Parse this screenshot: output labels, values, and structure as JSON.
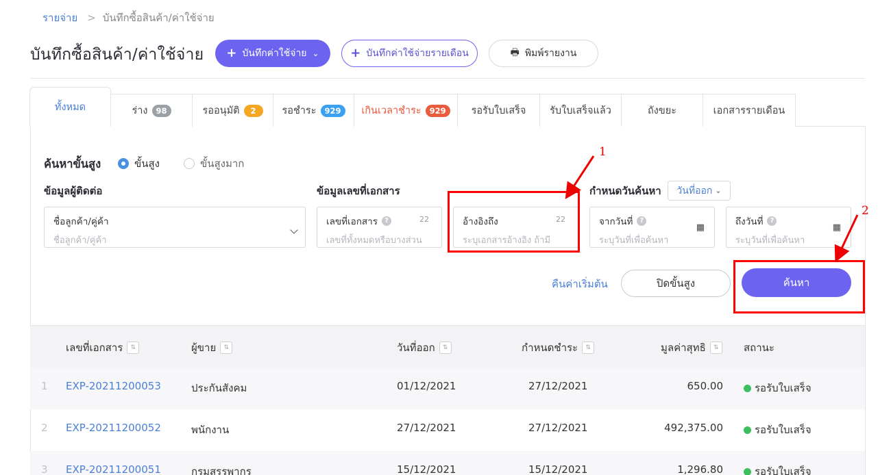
{
  "breadcrumb": {
    "root": "รายจ่าย",
    "separator": ">",
    "current": "บันทึกซื้อสินค้า/ค่าใช้จ่าย"
  },
  "page": {
    "title": "บันทึกซื้อสินค้า/ค่าใช้จ่าย"
  },
  "toolbar": {
    "add_expense": "บันทึกค่าใช้จ่าย",
    "add_monthly": "บันทึกค่าใช้จ่ายรายเดือน",
    "print_report": "พิมพ์รายงาน"
  },
  "tabs": [
    {
      "label": "ทั้งหมด"
    },
    {
      "label": "ร่าง",
      "badge": "98"
    },
    {
      "label": "รออนุมัติ",
      "badge": "2"
    },
    {
      "label": "รอชำระ",
      "badge": "929"
    },
    {
      "label": "เกินเวลาชำระ",
      "badge": "929"
    },
    {
      "label": "รอรับใบเสร็จ"
    },
    {
      "label": "รับใบเสร็จแล้ว"
    },
    {
      "label": "ถังขยะ"
    },
    {
      "label": "เอกสารรายเดือน"
    }
  ],
  "search": {
    "title": "ค้นหาขั้นสูง",
    "mode_advanced": "ขั้นสูง",
    "mode_very_advanced": "ขั้นสูงมาก",
    "section_contact": "ข้อมูลผู้ติดต่อ",
    "section_doc": "ข้อมูลเลขที่เอกสาร",
    "section_date": "กำหนดวันค้นหา",
    "date_type": "วันที่ออก",
    "contact_label": "ชื่อลูกค้า/คู่ค้า",
    "contact_placeholder": "ชื่อลูกค้า/คู่ค้า",
    "doc_label": "เลขที่เอกสาร",
    "doc_count": "22",
    "doc_placeholder": "เลขที่ทั้งหมดหรือบางส่วน",
    "ref_label": "อ้างอิงถึง",
    "ref_count": "22",
    "ref_placeholder": "ระบุเอกสารอ้างอิง ถ้ามี",
    "from_label": "จากวันที่",
    "from_placeholder": "ระบุวันที่เพื่อค้นหา",
    "to_label": "ถึงวันที่",
    "to_placeholder": "ระบุวันที่เพื่อค้นหา",
    "reset": "คืนค่าเริ่มต้น",
    "close_advanced": "ปิดขั้นสูง",
    "submit": "ค้นหา"
  },
  "annotations": {
    "one": "1",
    "two": "2"
  },
  "table": {
    "headers": {
      "doc_no": "เลขที่เอกสาร",
      "vendor": "ผู้ขาย",
      "issue_date": "วันที่ออก",
      "due_date": "กำหนดชำระ",
      "net": "มูลค่าสุทธิ",
      "status": "สถานะ"
    },
    "rows": [
      {
        "idx": "1",
        "doc_no": "EXP-20211200053",
        "vendor": "ประกันสังคม",
        "issue_date": "01/12/2021",
        "due_date": "27/12/2021",
        "net": "650.00",
        "status": "รอรับใบเสร็จ"
      },
      {
        "idx": "2",
        "doc_no": "EXP-20211200052",
        "vendor": "พนักงาน",
        "issue_date": "27/12/2021",
        "due_date": "27/12/2021",
        "net": "492,375.00",
        "status": "รอรับใบเสร็จ"
      },
      {
        "idx": "3",
        "doc_no": "EXP-20211200051",
        "vendor": "กรมสรรพากร",
        "issue_date": "15/12/2021",
        "due_date": "15/12/2021",
        "net": "1,296.80",
        "status": "รอรับใบเสร็จ"
      }
    ]
  },
  "colors": {
    "accent": "#6c63f0",
    "link": "#4a7fd6",
    "highlight": "#ff0000",
    "status_ok": "#3cbf5f"
  }
}
